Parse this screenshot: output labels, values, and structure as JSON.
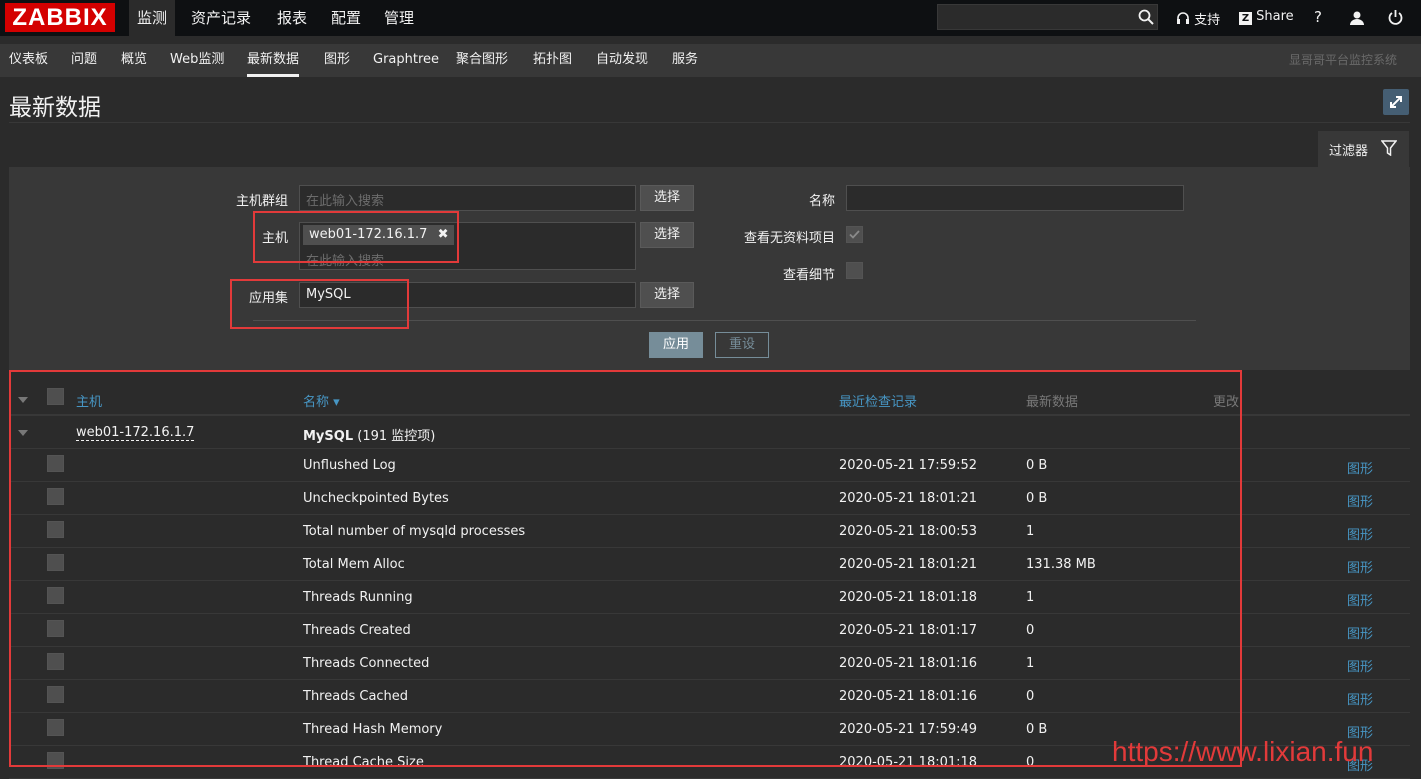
{
  "logo": "ZABBIX",
  "top_menu": [
    "监测",
    "资产记录",
    "报表",
    "配置",
    "管理"
  ],
  "top_right": {
    "support": "支持",
    "share": "Share",
    "help": "?"
  },
  "sub_menu": [
    "仪表板",
    "问题",
    "概览",
    "Web监测",
    "最新数据",
    "图形",
    "Graphtree",
    "聚合图形",
    "拓扑图",
    "自动发现",
    "服务"
  ],
  "brand": "显哥哥平台监控系统",
  "page_title": "最新数据",
  "filter": {
    "tab_label": "过滤器",
    "host_group_label": "主机群组",
    "host_group_placeholder": "在此输入搜索",
    "host_label": "主机",
    "host_chip": "web01-172.16.1.7",
    "host_placeholder": "在此输入搜索",
    "app_label": "应用集",
    "app_value": "MySQL",
    "select_label": "选择",
    "name_label": "名称",
    "show_no_data_label": "查看无资料项目",
    "show_no_data_checked": true,
    "show_details_label": "查看细节",
    "show_details_checked": false,
    "apply_label": "应用",
    "reset_label": "重设"
  },
  "table": {
    "headers": {
      "host": "主机",
      "name": "名称 ▾",
      "last_check": "最近检查记录",
      "last_value": "最新数据",
      "change": "更改"
    },
    "group_row": {
      "host": "web01-172.16.1.7",
      "app": "MySQL",
      "count": "(191 监控项)"
    },
    "rows": [
      {
        "name": "Unflushed Log",
        "last_check": "2020-05-21 17:59:52",
        "value": "0 B",
        "action": "图形"
      },
      {
        "name": "Uncheckpointed Bytes",
        "last_check": "2020-05-21 18:01:21",
        "value": "0 B",
        "action": "图形"
      },
      {
        "name": "Total number of mysqld processes",
        "last_check": "2020-05-21 18:00:53",
        "value": "1",
        "action": "图形"
      },
      {
        "name": "Total Mem Alloc",
        "last_check": "2020-05-21 18:01:21",
        "value": "131.38 MB",
        "action": "图形"
      },
      {
        "name": "Threads Running",
        "last_check": "2020-05-21 18:01:18",
        "value": "1",
        "action": "图形"
      },
      {
        "name": "Threads Created",
        "last_check": "2020-05-21 18:01:17",
        "value": "0",
        "action": "图形"
      },
      {
        "name": "Threads Connected",
        "last_check": "2020-05-21 18:01:16",
        "value": "1",
        "action": "图形"
      },
      {
        "name": "Threads Cached",
        "last_check": "2020-05-21 18:01:16",
        "value": "0",
        "action": "图形"
      },
      {
        "name": "Thread Hash Memory",
        "last_check": "2020-05-21 17:59:49",
        "value": "0 B",
        "action": "图形"
      },
      {
        "name": "Thread Cache Size",
        "last_check": "2020-05-21 18:01:18",
        "value": "0",
        "action": "图形"
      }
    ]
  },
  "watermark": "https://www.lixian.fun",
  "colors": {
    "logo_red": "#d40000",
    "link_blue": "#4796c4",
    "annotation_red": "#e23a3a",
    "apply_button": "#768d99"
  }
}
